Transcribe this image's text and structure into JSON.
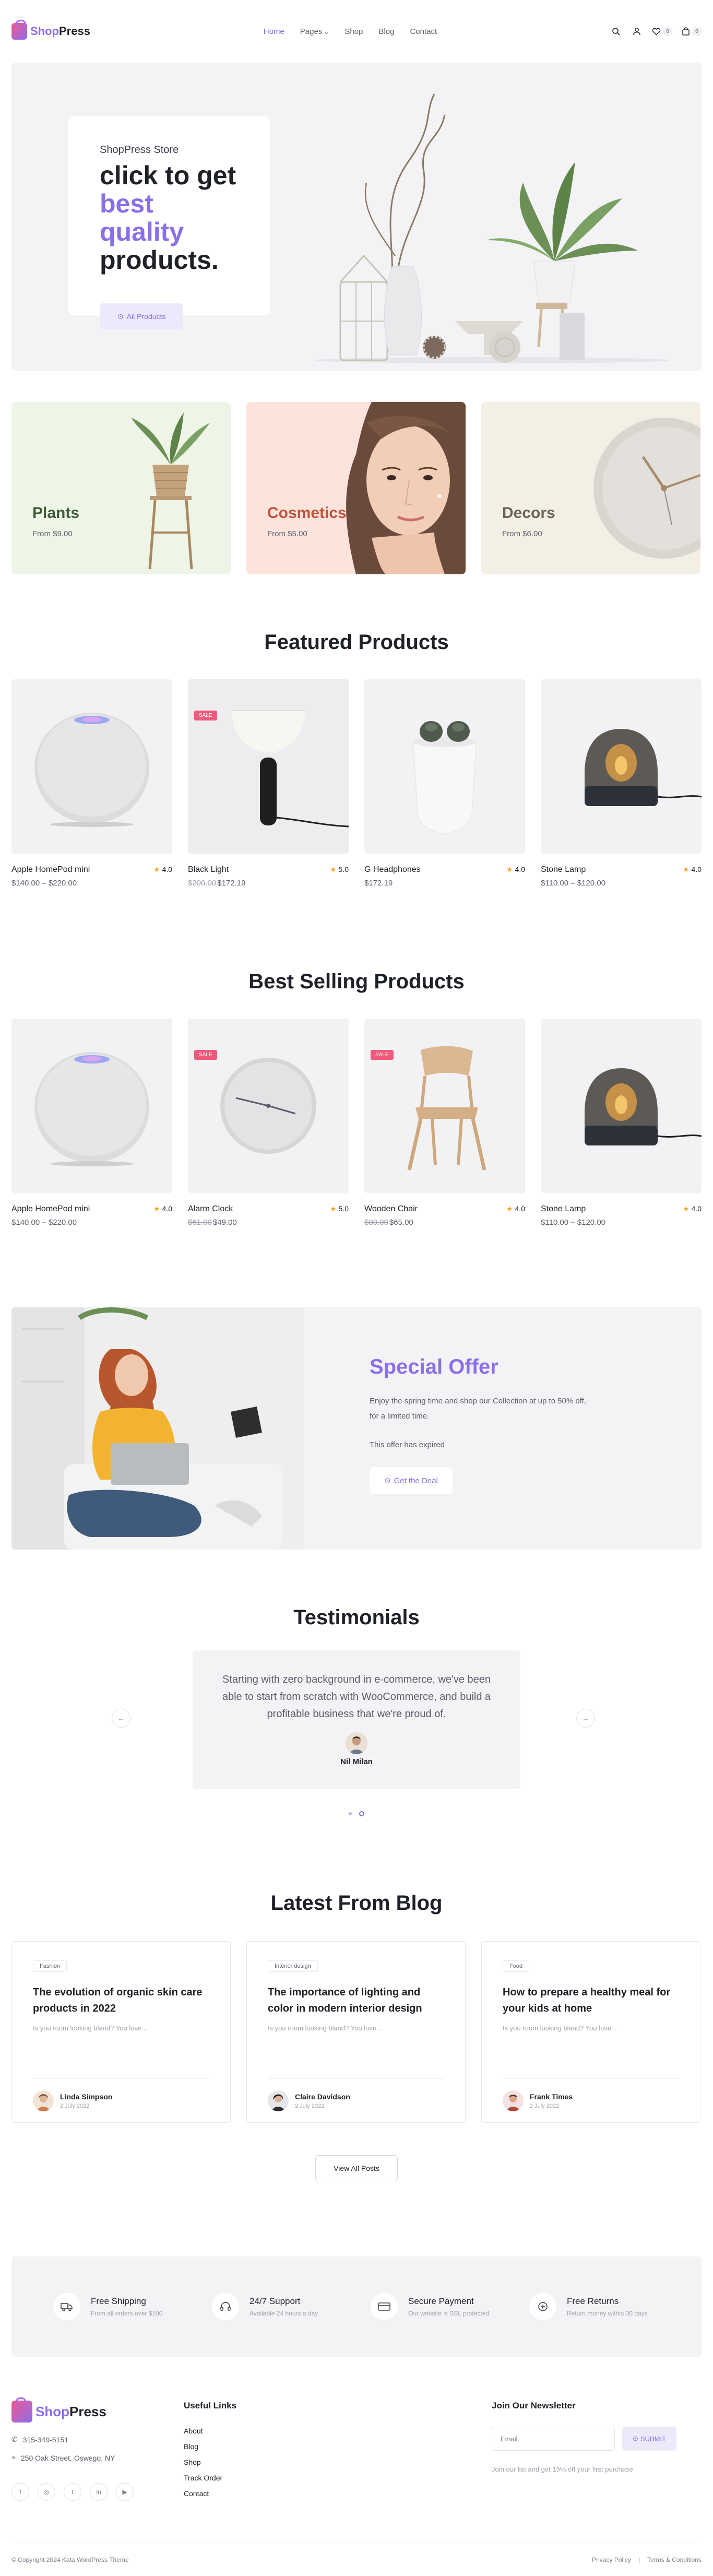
{
  "brand": {
    "shop": "Shop",
    "press": "Press"
  },
  "nav": {
    "items": [
      {
        "label": "Home"
      },
      {
        "label": "Pages"
      },
      {
        "label": "Shop"
      },
      {
        "label": "Blog"
      },
      {
        "label": "Contact"
      }
    ]
  },
  "header": {
    "wishlist_count": "0",
    "cart_count": "0"
  },
  "hero": {
    "eyebrow": "ShopPress Store",
    "title_1": "click to get",
    "title_accent": "best quality",
    "title_2": "products.",
    "button": "All Products"
  },
  "categories": [
    {
      "title": "Plants",
      "price": "From $9.00",
      "bg": "#eef5e6",
      "title_color": "#3f5c3a"
    },
    {
      "title": "Cosmetics",
      "price": "From $5.00",
      "bg": "#fce3dc",
      "title_color": "#c0553a"
    },
    {
      "title": "Decors",
      "price": "From $6.00",
      "bg": "#f4efe4",
      "title_color": "#6a6454"
    }
  ],
  "featured": {
    "title": "Featured Products",
    "items": [
      {
        "name": "Apple HomePod mini",
        "rating": "4.0",
        "price": "$140.00 – $220.00",
        "old_price": "",
        "sale": ""
      },
      {
        "name": "Black Light",
        "rating": "5.0",
        "price": "$172.19",
        "old_price": "$200.00",
        "sale": "SALE"
      },
      {
        "name": "G Headphones",
        "rating": "4.0",
        "price": "$172.19",
        "old_price": "",
        "sale": ""
      },
      {
        "name": "Stone Lamp",
        "rating": "4.0",
        "price": "$110.00 – $120.00",
        "old_price": "",
        "sale": ""
      }
    ]
  },
  "best": {
    "title": "Best Selling Products",
    "items": [
      {
        "name": "Apple HomePod mini",
        "rating": "4.0",
        "price": "$140.00 – $220.00",
        "old_price": "",
        "sale": ""
      },
      {
        "name": "Alarm Clock",
        "rating": "5.0",
        "price": "$49.00",
        "old_price": "$61.00",
        "sale": "SALE"
      },
      {
        "name": "Wooden Chair",
        "rating": "4.0",
        "price": "$65.00",
        "old_price": "$80.00",
        "sale": "SALE"
      },
      {
        "name": "Stone Lamp",
        "rating": "4.0",
        "price": "$110.00 – $120.00",
        "old_price": "",
        "sale": ""
      }
    ]
  },
  "offer": {
    "title": "Special Offer",
    "text": "Enjoy the spring time and shop our Collection at up to 50% off, for a limited time.",
    "expired": "This offer has expired",
    "button": "Get the Deal"
  },
  "testimonials": {
    "title": "Testimonials",
    "quote": "Starting with zero background in e-commerce, we've been able to start from scratch with WooCommerce, and build a profitable business that we're proud of.",
    "author": "Nil Milan"
  },
  "blog": {
    "title": "Latest From Blog",
    "posts": [
      {
        "tag": "Fashion",
        "title": "The evolution of organic skin care products in 2022",
        "excerpt": "Is you room looking bland? You love...",
        "author": "Linda Simpson",
        "date": "2 July 2022"
      },
      {
        "tag": "Interior design",
        "title": "The importance of lighting and color in modern interior design",
        "excerpt": "Is you room looking bland? You love...",
        "author": "Claire Davidson",
        "date": "2 July 2022"
      },
      {
        "tag": "Food",
        "title": "How to prepare a healthy meal for your kids at home",
        "excerpt": "Is you room looking bland? You love...",
        "author": "Frank Times",
        "date": "2 July 2022"
      }
    ],
    "view_all": "View All Posts"
  },
  "features": [
    {
      "title": "Free Shipping",
      "sub": "From all orders over $100",
      "icon": "truck-icon"
    },
    {
      "title": "24/7 Support",
      "sub": "Available 24 hours a day",
      "icon": "headset-icon"
    },
    {
      "title": "Secure Payment",
      "sub": "Our website is SSL protected",
      "icon": "card-icon"
    },
    {
      "title": "Free Returns",
      "sub": "Return money within 30 days",
      "icon": "return-icon"
    }
  ],
  "footer": {
    "phone": "315-349-5151",
    "address": "250 Oak Street, Oswego, NY",
    "links_title": "Useful Links",
    "links": [
      "About",
      "Blog",
      "Shop",
      "Track Order",
      "Contact"
    ],
    "newsletter_title": "Join Our Newsletter",
    "email_placeholder": "Email",
    "submit": "SUBMIT",
    "newsletter_note": "Join our list and get 15% off your first purchase",
    "copyright": "© Copyright 2024 Kata WordPress Theme",
    "privacy": "Privacy Policy",
    "terms": "Terms & Conditions"
  },
  "colors": {
    "accent": "#8a6fe8",
    "sale": "#f05a7a",
    "star": "#f5a623"
  }
}
